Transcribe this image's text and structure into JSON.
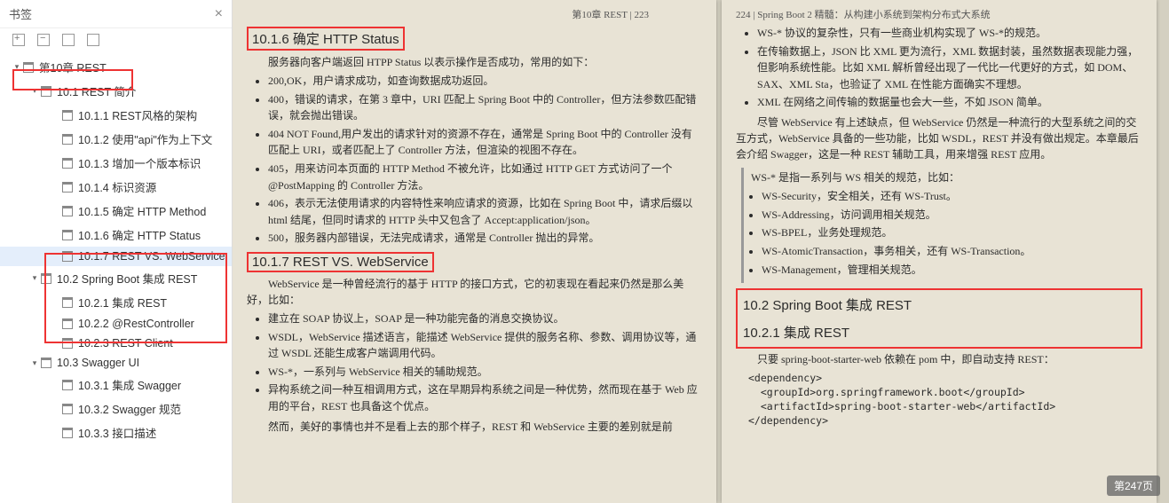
{
  "sidebar": {
    "title": "书签",
    "items": [
      {
        "lvl": 1,
        "twist": "▾",
        "label": "第10章 REST"
      },
      {
        "lvl": 2,
        "twist": "▾",
        "label": "10.1 REST 简介"
      },
      {
        "lvl": 3,
        "twist": "",
        "label": "10.1.1 REST风格的架构"
      },
      {
        "lvl": 3,
        "twist": "",
        "label": "10.1.2 使用\"api\"作为上下文"
      },
      {
        "lvl": 3,
        "twist": "",
        "label": "10.1.3 增加一个版本标识"
      },
      {
        "lvl": 3,
        "twist": "",
        "label": "10.1.4 标识资源"
      },
      {
        "lvl": 3,
        "twist": "",
        "label": "10.1.5 确定 HTTP Method"
      },
      {
        "lvl": 3,
        "twist": "",
        "label": "10.1.6 确定 HTTP Status"
      },
      {
        "lvl": 3,
        "twist": "",
        "label": "10.1.7 REST VS. WebService",
        "active": true
      },
      {
        "lvl": 2,
        "twist": "▾",
        "label": "10.2 Spring Boot 集成 REST"
      },
      {
        "lvl": 3,
        "twist": "",
        "label": "10.2.1 集成 REST"
      },
      {
        "lvl": 3,
        "twist": "",
        "label": "10.2.2 @RestController"
      },
      {
        "lvl": 3,
        "twist": "",
        "label": "10.2.3 REST Client"
      },
      {
        "lvl": 2,
        "twist": "▾",
        "label": "10.3 Swagger UI"
      },
      {
        "lvl": 3,
        "twist": "",
        "label": "10.3.1 集成 Swagger"
      },
      {
        "lvl": 3,
        "twist": "",
        "label": "10.3.2 Swagger 规范"
      },
      {
        "lvl": 3,
        "twist": "",
        "label": "10.3.3 接口描述"
      }
    ]
  },
  "leftPage": {
    "head": "第10章  REST   |   223",
    "h1": "10.1.6  确定 HTTP Status",
    "intro": "服务器向客户端返回 HTPP Status 以表示操作是否成功，常用的如下：",
    "bullets1": [
      "200,OK，用户请求成功，如查询数据成功返回。",
      "400，错误的请求，在第 3 章中，URI 匹配上 Spring Boot 中的 Controller，但方法参数匹配错误，就会抛出错误。",
      "404 NOT Found,用户发出的请求针对的资源不存在，通常是 Spring Boot 中的 Controller 没有匹配上 URI，或者匹配上了 Controller 方法，但渲染的视图不存在。",
      "405，用来访问本页面的 HTTP Method 不被允许，比如通过 HTTP GET 方式访问了一个@PostMapping 的 Controller 方法。",
      "406，表示无法使用请求的内容特性来响应请求的资源，比如在 Spring Boot 中，请求后缀以 html 结尾，但同时请求的 HTTP 头中又包含了 Accept:application/json。",
      "500，服务器内部错误，无法完成请求，通常是 Controller 抛出的异常。"
    ],
    "h2": "10.1.7  REST VS. WebService",
    "p2": "WebService 是一种曾经流行的基于 HTTP 的接口方式，它的初衷现在看起来仍然是那么美好，比如：",
    "bullets2": [
      "建立在 SOAP 协议上，SOAP 是一种功能完备的消息交换协议。",
      "WSDL，WebService 描述语言，能描述 WebService 提供的服务名称、参数、调用协议等，通过 WSDL 还能生成客户端调用代码。",
      "WS-*，一系列与 WebService 相关的辅助规范。",
      "异构系统之间一种互相调用方式，这在早期异构系统之间是一种优势，然而现在基于 Web 应用的平台，REST 也具备这个优点。"
    ],
    "tail": "然而，美好的事情也并不是看上去的那个样子，REST 和 WebService 主要的差别就是前"
  },
  "rightPage": {
    "head": "224   |   Spring Boot 2 精髓：从构建小系统到架构分布式大系统",
    "bulletsTop": [
      "WS-* 协议的复杂性，只有一些商业机构实现了 WS-*的规范。",
      "在传输数据上，JSON 比 XML 更为流行，XML 数据封装，虽然数据表现能力强，但影响系统性能。比如 XML 解析曾经出现了一代比一代更好的方式，如 DOM、SAX、XML Sta，也验证了 XML 在性能方面确实不理想。",
      "XML 在网络之间传输的数据量也会大一些，不如 JSON 简单。"
    ],
    "p1": "尽管 WebService 有上述缺点，但 WebService 仍然是一种流行的大型系统之间的交互方式，WebService 具备的一些功能，比如 WSDL，REST 并没有做出规定。本章最后会介绍 Swagger，这是一种 REST 辅助工具，用来增强 REST 应用。",
    "noteTitle": "WS-* 是指一系列与 WS 相关的规范，比如：",
    "noteItems": [
      "WS-Security，安全相关，还有 WS-Trust。",
      "WS-Addressing，访问调用相关规范。",
      "WS-BPEL，业务处理规范。",
      "WS-AtomicTransaction，事务相关，还有 WS-Transaction。",
      "WS-Management，管理相关规范。"
    ],
    "h102": "10.2  Spring Boot 集成 REST",
    "h1021": "10.2.1  集成 REST",
    "p2": "只要 spring-boot-starter-web 依赖在 pom 中，即自动支持 REST：",
    "code": "<dependency>\n  <groupId>org.springframework.boot</groupId>\n  <artifactId>spring-boot-starter-web</artifactId>\n</dependency>"
  },
  "pageBadge": "第247页"
}
